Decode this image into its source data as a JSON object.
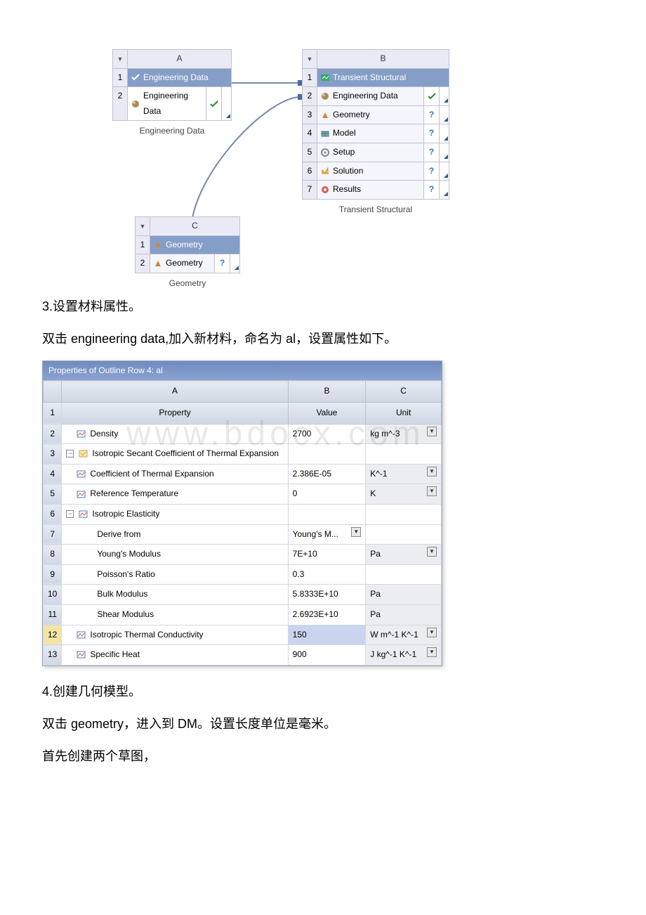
{
  "schematic": {
    "A": {
      "col": "A",
      "title": "Engineering Data",
      "row2": "Engineering Data",
      "caption": "Engineering Data"
    },
    "B": {
      "col": "B",
      "title": "Transient Structural",
      "rows": [
        {
          "n": "2",
          "label": "Engineering Data",
          "icon": "material"
        },
        {
          "n": "3",
          "label": "Geometry",
          "icon": "geometry"
        },
        {
          "n": "4",
          "label": "Model",
          "icon": "model"
        },
        {
          "n": "5",
          "label": "Setup",
          "icon": "setup"
        },
        {
          "n": "6",
          "label": "Solution",
          "icon": "solution"
        },
        {
          "n": "7",
          "label": "Results",
          "icon": "results"
        }
      ],
      "caption": "Transient Structural"
    },
    "C": {
      "col": "C",
      "title": "Geometry",
      "row2": "Geometry",
      "caption": "Geometry"
    }
  },
  "para3": "3.设置材料属性。",
  "para3b": "双击 engineering data,加入新材料，命名为 al，设置属性如下。",
  "props": {
    "title": "Properties of Outline Row 4: al",
    "headers": {
      "A": "A",
      "B": "B",
      "C": "C",
      "name": "Property",
      "value": "Value",
      "unit": "Unit"
    },
    "rows": [
      {
        "n": "2",
        "name": "Density",
        "value": "2700",
        "unit": "kg m^-3",
        "dd": true,
        "icon": true,
        "indent": 1
      },
      {
        "n": "3",
        "name": "Isotropic Secant Coefficient of Thermal Expansion",
        "value": "",
        "unit": "",
        "expand": true,
        "icon": true,
        "indent": 0
      },
      {
        "n": "4",
        "name": "Coefficient of Thermal Expansion",
        "value": "2.386E-05",
        "unit": "K^-1",
        "dd": true,
        "icon": true,
        "indent": 1
      },
      {
        "n": "5",
        "name": "Reference Temperature",
        "value": "0",
        "unit": "K",
        "dd": true,
        "icon": true,
        "indent": 1
      },
      {
        "n": "6",
        "name": "Isotropic Elasticity",
        "value": "",
        "unit": "",
        "expand": true,
        "icon": true,
        "indent": 0
      },
      {
        "n": "7",
        "name": "Derive from",
        "value": "Young's M...",
        "unit": "",
        "valdd": true,
        "indent": 2
      },
      {
        "n": "8",
        "name": "Young's Modulus",
        "value": "7E+10",
        "unit": "Pa",
        "dd": true,
        "indent": 2
      },
      {
        "n": "9",
        "name": "Poisson's Ratio",
        "value": "0.3",
        "unit": "",
        "indent": 2
      },
      {
        "n": "10",
        "name": "Bulk Modulus",
        "value": "5.8333E+10",
        "unit": "Pa",
        "unitgrey": true,
        "indent": 2
      },
      {
        "n": "11",
        "name": "Shear Modulus",
        "value": "2.6923E+10",
        "unit": "Pa",
        "unitgrey": true,
        "indent": 2
      },
      {
        "n": "12",
        "name": "Isotropic Thermal Conductivity",
        "value": "150",
        "unit": "W m^-1 K^-1",
        "dd": true,
        "sel": true,
        "icon": true,
        "indent": 1
      },
      {
        "n": "13",
        "name": "Specific Heat",
        "value": "900",
        "unit": "J kg^-1 K^-1",
        "dd": true,
        "icon": true,
        "indent": 1
      }
    ]
  },
  "para4": "4.创建几何模型。",
  "para4b": "双击 geometry，进入到 DM。设置长度单位是毫米。",
  "para4c": "首先创建两个草图，",
  "watermark": "www.bdocx.com",
  "glyphs": {
    "dd": "▼",
    "tri": "◢",
    "check": "✓",
    "q": "?",
    "minus": "−"
  }
}
